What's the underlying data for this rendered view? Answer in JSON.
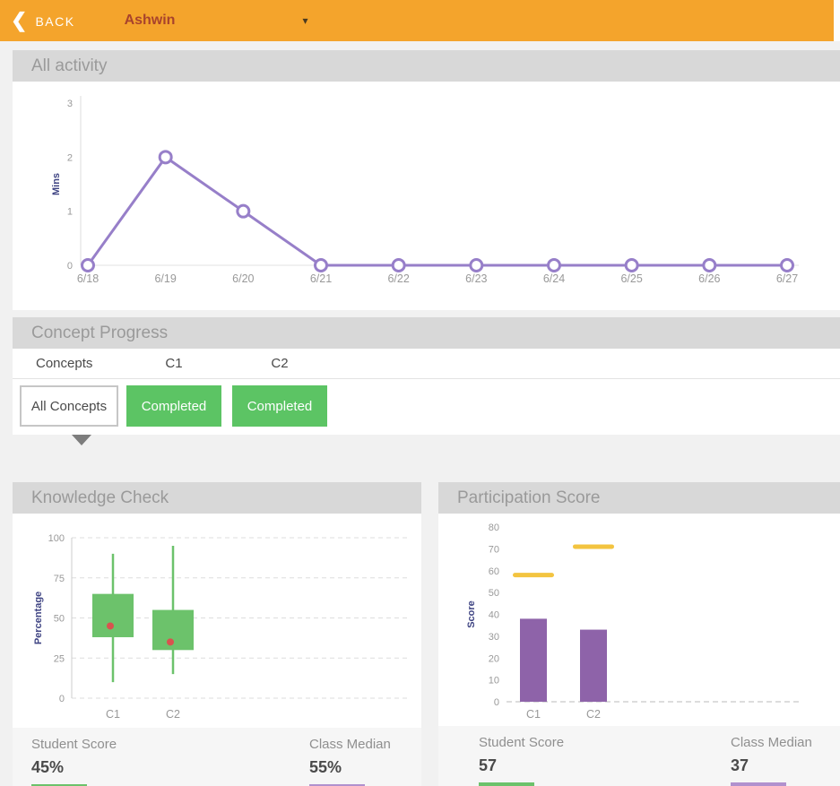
{
  "topbar": {
    "back_label": "BACK",
    "student_name": "Ashwin"
  },
  "icons": {
    "back_chevron": "❮",
    "dropdown_caret": "▾"
  },
  "colors": {
    "topbar_orange": "#F4A42C",
    "section_header_gray": "#D8D8D8",
    "completed_green": "#5CC464",
    "line_purple": "#977FC9",
    "bar_purple": "#8E63A9",
    "box_green": "#6CC26B",
    "dash_yellow": "#F3C440",
    "dot_red": "#D9534F",
    "underline_green": "#6CC26B",
    "underline_purple": "#B191CE"
  },
  "sections": {
    "all_activity": {
      "title": "All activity"
    },
    "concept_progress": {
      "title": "Concept Progress",
      "columns": [
        "Concepts",
        "C1",
        "C2"
      ],
      "all_concepts_label": "All Concepts",
      "statuses": [
        "Completed",
        "Completed"
      ]
    },
    "knowledge_check": {
      "title": "Knowledge Check",
      "student_score_label": "Student Score",
      "student_score_value": "45%",
      "class_median_label": "Class Median",
      "class_median_value": "55%"
    },
    "participation_score": {
      "title": "Participation Score",
      "student_score_label": "Student Score",
      "student_score_value": "57",
      "class_median_label": "Class Median",
      "class_median_value": "37"
    }
  },
  "chart_data": [
    {
      "id": "all-activity",
      "type": "line",
      "title": "All activity",
      "x": [
        "6/18",
        "6/19",
        "6/20",
        "6/21",
        "6/22",
        "6/23",
        "6/24",
        "6/25",
        "6/26",
        "6/27"
      ],
      "values": [
        0,
        2,
        1,
        0,
        0,
        0,
        0,
        0,
        0,
        0
      ],
      "ylabel": "Mins",
      "yticks": [
        0,
        1,
        2,
        3
      ],
      "ylim": [
        0,
        3
      ],
      "line_color": "#977FC9",
      "marker": "open-circle",
      "grid": false
    },
    {
      "id": "knowledge-check",
      "type": "boxplot",
      "title": "Knowledge Check",
      "categories": [
        "C1",
        "C2"
      ],
      "ylabel": "Percentage",
      "yticks": [
        0,
        25,
        50,
        75,
        100
      ],
      "ylim": [
        0,
        100
      ],
      "grid": "dashed-horizontal",
      "box_color": "#6CC26B",
      "dot_color": "#D9534F",
      "series": [
        {
          "category": "C1",
          "whisker_low": 10,
          "box_low": 38,
          "box_high": 65,
          "whisker_high": 90,
          "dot": 45
        },
        {
          "category": "C2",
          "whisker_low": 15,
          "box_low": 30,
          "box_high": 55,
          "whisker_high": 95,
          "dot": 35
        }
      ]
    },
    {
      "id": "participation-score",
      "type": "bar",
      "title": "Participation Score",
      "categories": [
        "C1",
        "C2"
      ],
      "ylabel": "Score",
      "yticks": [
        0,
        10,
        20,
        30,
        40,
        50,
        60,
        70,
        80
      ],
      "ylim": [
        0,
        80
      ],
      "grid": "dashed-zero-line",
      "series": [
        {
          "name": "Class Median",
          "style": "bar",
          "color": "#8E63A9",
          "values": [
            38,
            33
          ]
        },
        {
          "name": "Student Score",
          "style": "dash",
          "color": "#F3C440",
          "values": [
            58,
            71
          ]
        }
      ]
    }
  ]
}
